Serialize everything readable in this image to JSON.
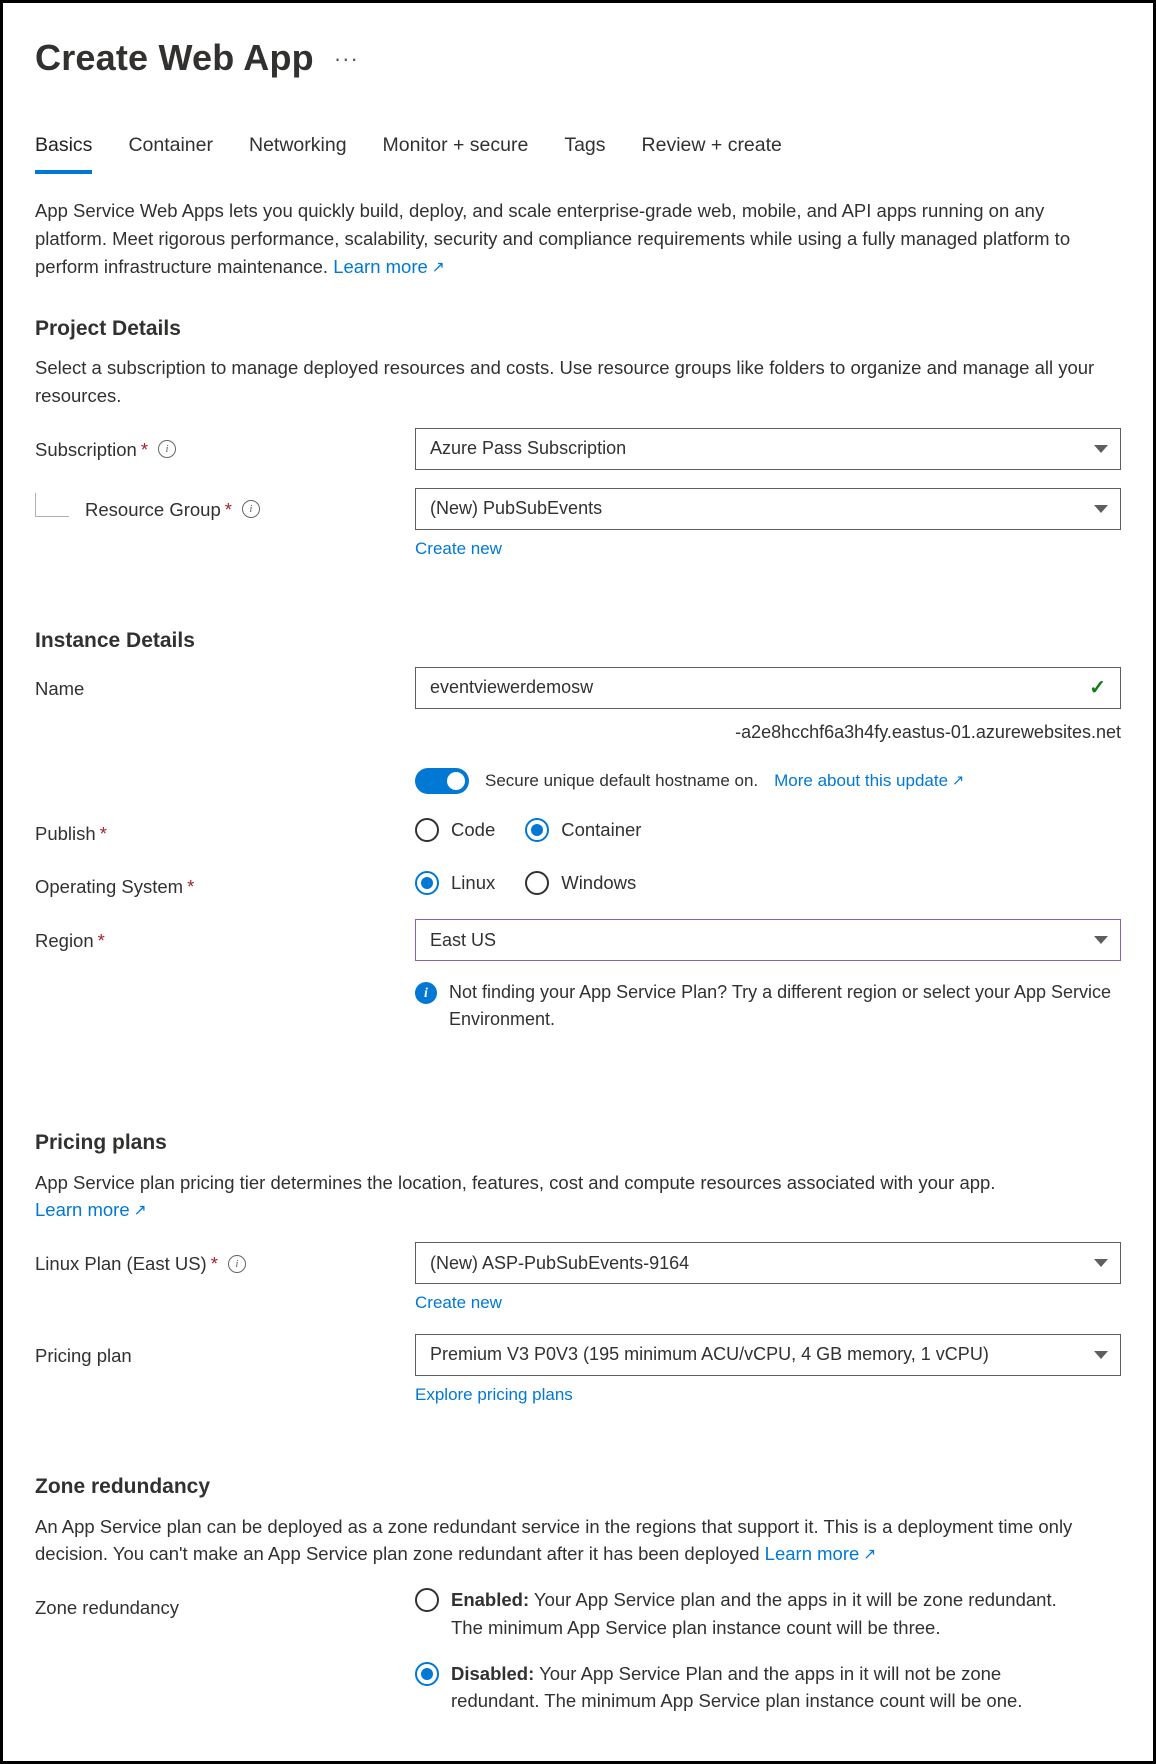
{
  "header": {
    "title": "Create Web App"
  },
  "tabs": {
    "items": [
      {
        "label": "Basics",
        "active": true
      },
      {
        "label": "Container",
        "active": false
      },
      {
        "label": "Networking",
        "active": false
      },
      {
        "label": "Monitor + secure",
        "active": false
      },
      {
        "label": "Tags",
        "active": false
      },
      {
        "label": "Review + create",
        "active": false
      }
    ]
  },
  "intro": {
    "text": "App Service Web Apps lets you quickly build, deploy, and scale enterprise-grade web, mobile, and API apps running on any platform. Meet rigorous performance, scalability, security and compliance requirements while using a fully managed platform to perform infrastructure maintenance.  ",
    "learn_more": "Learn more"
  },
  "project": {
    "heading": "Project Details",
    "desc": "Select a subscription to manage deployed resources and costs. Use resource groups like folders to organize and manage all your resources.",
    "subscription_label": "Subscription",
    "subscription_value": "Azure Pass Subscription",
    "rg_label": "Resource Group",
    "rg_value": "(New) PubSubEvents",
    "create_new": "Create new"
  },
  "instance": {
    "heading": "Instance Details",
    "name_label": "Name",
    "name_value": "eventviewerdemosw",
    "domain_suffix": "-a2e8hcchf6a3h4fy.eastus-01.azurewebsites.net",
    "toggle_label": "Secure unique default hostname on.",
    "toggle_link": "More about this update",
    "publish_label": "Publish",
    "publish_options": [
      {
        "label": "Code",
        "selected": false
      },
      {
        "label": "Container",
        "selected": true
      }
    ],
    "os_label": "Operating System",
    "os_options": [
      {
        "label": "Linux",
        "selected": true
      },
      {
        "label": "Windows",
        "selected": false
      }
    ],
    "region_label": "Region",
    "region_value": "East US",
    "region_hint": "Not finding your App Service Plan? Try a different region or select your App Service Environment."
  },
  "pricing": {
    "heading": "Pricing plans",
    "desc_text": "App Service plan pricing tier determines the location, features, cost and compute resources associated with your app. ",
    "desc_link": "Learn more",
    "plan_label": "Linux Plan (East US)",
    "plan_value": "(New) ASP-PubSubEvents-9164",
    "create_new": "Create new",
    "tier_label": "Pricing plan",
    "tier_value": "Premium V3 P0V3 (195 minimum ACU/vCPU, 4 GB memory, 1 vCPU)",
    "explore": "Explore pricing plans"
  },
  "zone": {
    "heading": "Zone redundancy",
    "desc_text": "An App Service plan can be deployed as a zone redundant service in the regions that support it. This is a deployment time only decision. You can't make an App Service plan zone redundant after it has been deployed ",
    "desc_link": "Learn more",
    "field_label": "Zone redundancy",
    "enabled_strong": "Enabled:",
    "enabled_text": " Your App Service plan and the apps in it will be zone redundant. The minimum App Service plan instance count will be three.",
    "disabled_strong": "Disabled:",
    "disabled_text": " Your App Service Plan and the apps in it will not be zone redundant. The minimum App Service plan instance count will be one."
  }
}
